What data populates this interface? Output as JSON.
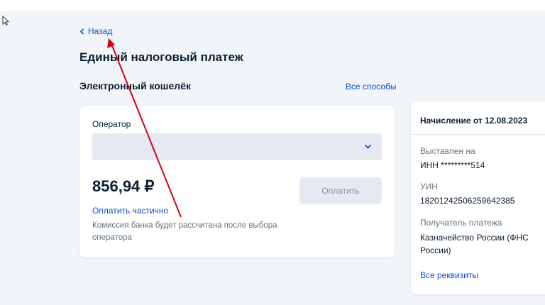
{
  "nav": {
    "back_label": "Назад"
  },
  "page": {
    "title": "Единый налоговый платеж",
    "section_title": "Электронный кошелёк",
    "all_methods_label": "Все способы"
  },
  "payment": {
    "operator_label": "Оператор",
    "operator_value": "",
    "amount": "856,94 ₽",
    "pay_button_label": "Оплатить",
    "pay_partial_label": "Оплатить частично",
    "commission_note": "Комиссия банка будет рассчитана после выбора оператора"
  },
  "details": {
    "title": "Начисление от 12.08.2023",
    "issued_label": "Выставлен на",
    "issued_value": "ИНН *********514",
    "uin_label": "УИН",
    "uin_value": "18201242506259642385",
    "recipient_label": "Получатель платежа",
    "recipient_value": "Казначейство России (ФНС России)",
    "all_details_label": "Все реквизиты"
  },
  "colors": {
    "accent": "#0d4cd3",
    "background": "#f1f4f8",
    "annotation_arrow": "#d0021b"
  }
}
